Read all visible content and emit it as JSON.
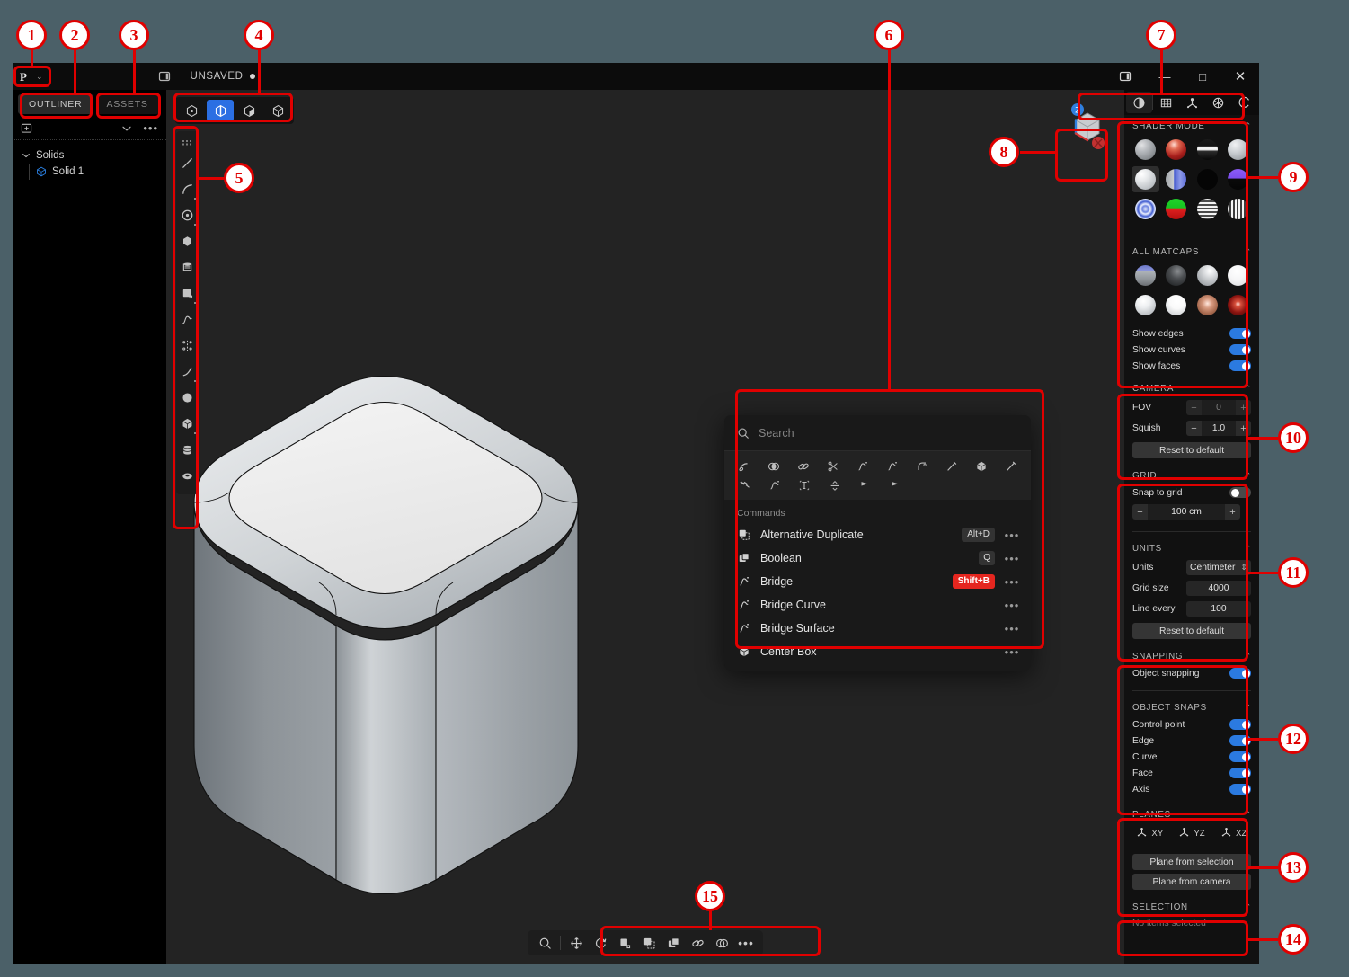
{
  "window": {
    "title": "UNSAVED",
    "modified_dot": "●",
    "logo_glyph": "P",
    "minimize": "—",
    "maximize": "□",
    "close": "✕"
  },
  "left_panel": {
    "tabs": [
      {
        "label": "OUTLINER",
        "active": true
      },
      {
        "label": "ASSETS",
        "active": false
      }
    ],
    "tree": [
      {
        "label": "Solids",
        "type": "group"
      },
      {
        "label": "Solid 1",
        "type": "solid"
      }
    ]
  },
  "viewport": {
    "toolbar": [
      {
        "icon": "point-select-icon",
        "active": false
      },
      {
        "icon": "edge-select-icon",
        "active": true
      },
      {
        "icon": "face-select-icon",
        "active": false
      },
      {
        "icon": "solid-select-icon",
        "active": false
      }
    ],
    "left_tools": [
      {
        "icon": "grip-handle-icon"
      },
      {
        "icon": "line-icon"
      },
      {
        "icon": "curve-icon"
      },
      {
        "icon": "circle-icon"
      },
      {
        "icon": "polygon-icon"
      },
      {
        "icon": "cylinder-sketch-icon"
      },
      {
        "icon": "rectangle-icon"
      },
      {
        "icon": "spline-icon"
      },
      {
        "icon": "mirror-icon"
      },
      {
        "icon": "arc-icon"
      },
      {
        "icon": "sphere-icon"
      },
      {
        "icon": "box-icon"
      },
      {
        "icon": "cylinder-icon"
      },
      {
        "icon": "torus-icon"
      }
    ],
    "gizmo": {
      "z_label": "Z",
      "x_label": "X"
    }
  },
  "palette": {
    "search_placeholder": "Search",
    "icons_row1": [
      "sweep-icon",
      "boolean-icon",
      "chain-icon",
      "trim-icon",
      "bridge-icon",
      "bridge-curve-icon",
      "fillet-icon",
      "offset-line-icon",
      "center-box-icon",
      "pipe-icon"
    ],
    "icons_row2": [
      "hammer-icon",
      "bridge-surface-icon",
      "text-icon",
      "divide-icon",
      "flag-icon",
      "flag-alt-icon"
    ],
    "section_label": "Commands",
    "commands": [
      {
        "icon": "alt-duplicate-icon",
        "name": "Alternative Duplicate",
        "shortcut": "Alt+D",
        "shortcut_style": "normal",
        "more": "•••"
      },
      {
        "icon": "boolean-icon",
        "name": "Boolean",
        "shortcut": "Q",
        "shortcut_style": "normal",
        "more": "•••"
      },
      {
        "icon": "bridge-icon",
        "name": "Bridge",
        "shortcut": "Shift+B",
        "shortcut_style": "hot",
        "more": "•••"
      },
      {
        "icon": "bridge-curve-icon",
        "name": "Bridge Curve",
        "shortcut": "",
        "shortcut_style": "none",
        "more": "•••"
      },
      {
        "icon": "bridge-surface-icon",
        "name": "Bridge Surface",
        "shortcut": "",
        "shortcut_style": "none",
        "more": "•••"
      },
      {
        "icon": "center-box-icon",
        "name": "Center Box",
        "shortcut": "",
        "shortcut_style": "none",
        "more": "•••"
      }
    ]
  },
  "bottom_toolbar": [
    {
      "icon": "search-icon"
    },
    {
      "icon": "move-icon"
    },
    {
      "icon": "rotate-icon"
    },
    {
      "icon": "scale-icon"
    },
    {
      "icon": "duplicate-dashed-icon"
    },
    {
      "icon": "duplicate-icon"
    },
    {
      "icon": "chain-icon"
    },
    {
      "icon": "boolean-icon"
    },
    {
      "icon": "more-icon"
    }
  ],
  "right_panel": {
    "topbar": [
      {
        "icon": "contrast-icon"
      },
      {
        "icon": "grid-icon"
      },
      {
        "icon": "plane-icon"
      },
      {
        "icon": "snap-icon"
      },
      {
        "icon": "selection-icon"
      }
    ],
    "shader_mode": {
      "title": "SHADER MODE",
      "caret": "⌃",
      "matcaps": [
        {
          "name": "gray-pearl",
          "selected": false
        },
        {
          "name": "red-dotted",
          "selected": false
        },
        {
          "name": "black-white-band",
          "selected": false
        },
        {
          "name": "light-gray",
          "selected": false
        },
        {
          "name": "white-chrome",
          "selected": true
        },
        {
          "name": "blue-checker-half",
          "selected": false
        },
        {
          "name": "pure-black",
          "selected": false
        },
        {
          "name": "purple-black",
          "selected": false
        },
        {
          "name": "blue-pattern",
          "selected": false
        },
        {
          "name": "green-red",
          "selected": false
        },
        {
          "name": "horizontal-stripes",
          "selected": false
        },
        {
          "name": "vertical-stripes",
          "selected": false
        }
      ]
    },
    "all_matcaps": {
      "title": "ALL MATCAPS",
      "caret": "⌃",
      "matcaps": [
        {
          "name": "blue-speckled"
        },
        {
          "name": "dark-metal"
        },
        {
          "name": "silver"
        },
        {
          "name": "white-matte"
        },
        {
          "name": "light-chrome"
        },
        {
          "name": "white-gloss"
        },
        {
          "name": "copper-speckled"
        },
        {
          "name": "dark-red-glow"
        }
      ]
    },
    "display_toggles": [
      {
        "label": "Show edges",
        "on": true
      },
      {
        "label": "Show curves",
        "on": true
      },
      {
        "label": "Show faces",
        "on": true
      }
    ],
    "camera": {
      "title": "CAMERA",
      "caret": "⌃",
      "fov": {
        "label": "FOV",
        "value": "0",
        "minus": "−",
        "plus": "+",
        "disabled": true
      },
      "squish": {
        "label": "Squish",
        "value": "1.0",
        "minus": "−",
        "plus": "+",
        "disabled": false
      },
      "reset_label": "Reset to default"
    },
    "grid": {
      "title": "GRID",
      "caret": "⌃",
      "snap_to_grid": {
        "label": "Snap to grid",
        "on": false
      },
      "size": {
        "value": "100 cm",
        "minus": "−",
        "plus": "+"
      }
    },
    "units": {
      "title": "UNITS",
      "caret": "⌃",
      "units": {
        "label": "Units",
        "value": "Centimeter",
        "arrows": "⌃⌄"
      },
      "grid_size": {
        "label": "Grid size",
        "value": "4000"
      },
      "line_every": {
        "label": "Line every",
        "value": "100"
      },
      "reset_label": "Reset to default"
    },
    "snapping": {
      "title": "SNAPPING",
      "caret": "⌃",
      "object_snapping": {
        "label": "Object snapping",
        "on": true
      }
    },
    "object_snaps": {
      "title": "OBJECT SNAPS",
      "caret": "⌃",
      "items": [
        {
          "label": "Control point",
          "on": true
        },
        {
          "label": "Edge",
          "on": true
        },
        {
          "label": "Curve",
          "on": true
        },
        {
          "label": "Face",
          "on": true
        },
        {
          "label": "Axis",
          "on": true
        }
      ]
    },
    "planes": {
      "title": "PLANES",
      "caret": "⌃",
      "items": [
        {
          "label": "XY"
        },
        {
          "label": "YZ"
        },
        {
          "label": "XZ"
        }
      ],
      "from_selection": "Plane from selection",
      "from_camera": "Plane from camera"
    },
    "selection": {
      "title": "SELECTION",
      "caret": "⌃",
      "empty_text": "No items selected"
    }
  },
  "annotations": [
    {
      "n": "1"
    },
    {
      "n": "2"
    },
    {
      "n": "3"
    },
    {
      "n": "4"
    },
    {
      "n": "5"
    },
    {
      "n": "6"
    },
    {
      "n": "7"
    },
    {
      "n": "8"
    },
    {
      "n": "9"
    },
    {
      "n": "10"
    },
    {
      "n": "11"
    },
    {
      "n": "12"
    },
    {
      "n": "13"
    },
    {
      "n": "14"
    },
    {
      "n": "15"
    }
  ],
  "colors": {
    "page_bg": "#4b6068",
    "accent_blue": "#2b7ae0",
    "annotation_red": "#e00000",
    "app_bg": "#1b1b1b",
    "viewport_bg": "#232323"
  }
}
